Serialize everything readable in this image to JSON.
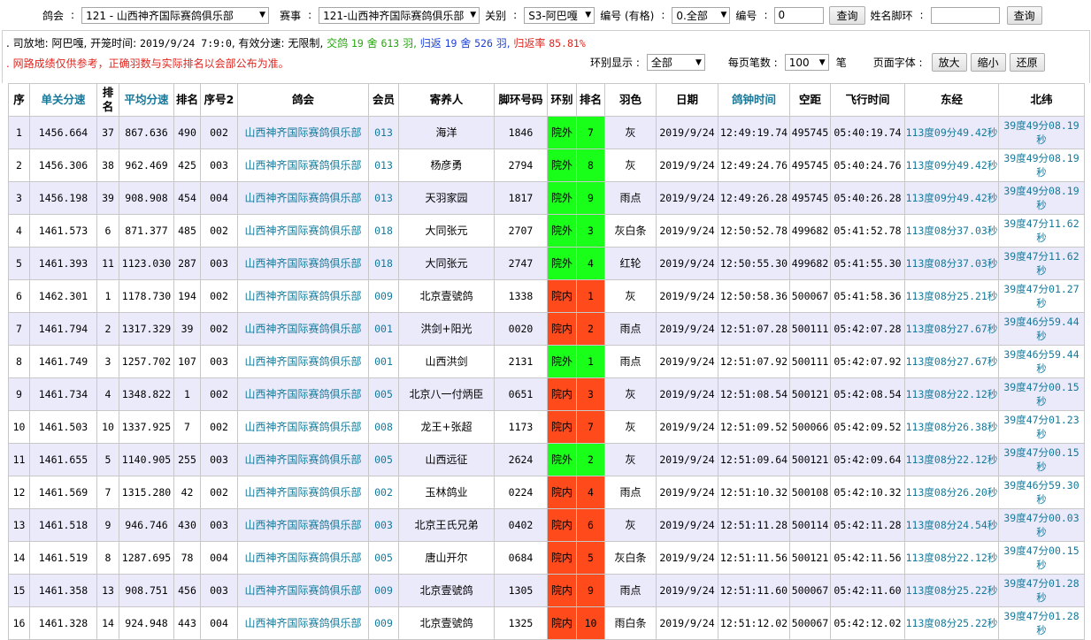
{
  "filters": {
    "club_label": "鸽会",
    "club_value": "121 - 山西神齐国际赛鸽俱乐部",
    "event_label": "赛事",
    "event_value": "121-山西神齐国际赛鸽俱乐部",
    "stage_label": "关别",
    "stage_value": "S3-阿巴嘎",
    "number_label": "编号 (有格)",
    "number_select": "0.全部",
    "number2_label": "编号",
    "number_input": "0",
    "query_label": "查询",
    "name_label": "姓名脚环",
    "name_input": "",
    "query2_label": "查询"
  },
  "info": {
    "site_label": ". 司放地:",
    "site_value": "阿巴嘎",
    "time_label": "开笼时间:",
    "time_value": "2019/9/24 7:9:0",
    "speed_label": "有效分速:",
    "speed_value": "无限制",
    "sent_label": "交鸽",
    "sent_count": "19",
    "sent_unit1": "舍",
    "sent_birds": "613",
    "sent_unit2": "羽",
    "return_label": "归返",
    "return_count": "19",
    "return_unit1": "舍",
    "return_birds": "526",
    "return_unit2": "羽",
    "rate_label": "归返率",
    "rate_value": "85.81%",
    "notice": ". 网路成绩仅供参考，正确羽数与实际排名以会部公布为准。"
  },
  "controls": {
    "ring_display_label": "环别显示 :",
    "ring_display_value": "全部",
    "per_page_label": "每页笔数 :",
    "per_page_value": "100",
    "per_page_unit": "笔",
    "font_label": "页面字体 :",
    "zoom_in": "放大",
    "zoom_out": "缩小",
    "reset": "还原"
  },
  "table": {
    "headers": [
      "序",
      "单关分速",
      "排名",
      "平均分速",
      "排名",
      "序号2",
      "鸽会",
      "会员",
      "寄养人",
      "脚环号码",
      "环别",
      "排名",
      "羽色",
      "日期",
      "鸽钟时间",
      "空距",
      "飞行时间",
      "东经",
      "北纬"
    ],
    "rows": [
      {
        "seq": "1",
        "speed": "1456.664",
        "rank1": "37",
        "avg": "867.636",
        "rank2": "490",
        "no2": "002",
        "club": "山西神齐国际赛鸽俱乐部",
        "member": "013",
        "owner": "海洋",
        "ring": "1846",
        "ring_type": "院外",
        "rank3": "7",
        "color": "灰",
        "date": "2019/9/24",
        "clock": "12:49:19.74",
        "dist": "495745",
        "flight": "05:40:19.74",
        "lon": "113度09分49.42秒",
        "lat": "39度49分08.19秒"
      },
      {
        "seq": "2",
        "speed": "1456.306",
        "rank1": "38",
        "avg": "962.469",
        "rank2": "425",
        "no2": "003",
        "club": "山西神齐国际赛鸽俱乐部",
        "member": "013",
        "owner": "杨彦勇",
        "ring": "2794",
        "ring_type": "院外",
        "rank3": "8",
        "color": "灰",
        "date": "2019/9/24",
        "clock": "12:49:24.76",
        "dist": "495745",
        "flight": "05:40:24.76",
        "lon": "113度09分49.42秒",
        "lat": "39度49分08.19秒"
      },
      {
        "seq": "3",
        "speed": "1456.198",
        "rank1": "39",
        "avg": "908.908",
        "rank2": "454",
        "no2": "004",
        "club": "山西神齐国际赛鸽俱乐部",
        "member": "013",
        "owner": "天羽家园",
        "ring": "1817",
        "ring_type": "院外",
        "rank3": "9",
        "color": "雨点",
        "date": "2019/9/24",
        "clock": "12:49:26.28",
        "dist": "495745",
        "flight": "05:40:26.28",
        "lon": "113度09分49.42秒",
        "lat": "39度49分08.19秒"
      },
      {
        "seq": "4",
        "speed": "1461.573",
        "rank1": "6",
        "avg": "871.377",
        "rank2": "485",
        "no2": "002",
        "club": "山西神齐国际赛鸽俱乐部",
        "member": "018",
        "owner": "大同张元",
        "ring": "2707",
        "ring_type": "院外",
        "rank3": "3",
        "color": "灰白条",
        "date": "2019/9/24",
        "clock": "12:50:52.78",
        "dist": "499682",
        "flight": "05:41:52.78",
        "lon": "113度08分37.03秒",
        "lat": "39度47分11.62秒"
      },
      {
        "seq": "5",
        "speed": "1461.393",
        "rank1": "11",
        "avg": "1123.030",
        "rank2": "287",
        "no2": "003",
        "club": "山西神齐国际赛鸽俱乐部",
        "member": "018",
        "owner": "大同张元",
        "ring": "2747",
        "ring_type": "院外",
        "rank3": "4",
        "color": "红轮",
        "date": "2019/9/24",
        "clock": "12:50:55.30",
        "dist": "499682",
        "flight": "05:41:55.30",
        "lon": "113度08分37.03秒",
        "lat": "39度47分11.62秒"
      },
      {
        "seq": "6",
        "speed": "1462.301",
        "rank1": "1",
        "avg": "1178.730",
        "rank2": "194",
        "no2": "002",
        "club": "山西神齐国际赛鸽俱乐部",
        "member": "009",
        "owner": "北京壹號鸽",
        "ring": "1338",
        "ring_type": "院内",
        "rank3": "1",
        "color": "灰",
        "date": "2019/9/24",
        "clock": "12:50:58.36",
        "dist": "500067",
        "flight": "05:41:58.36",
        "lon": "113度08分25.21秒",
        "lat": "39度47分01.27秒"
      },
      {
        "seq": "7",
        "speed": "1461.794",
        "rank1": "2",
        "avg": "1317.329",
        "rank2": "39",
        "no2": "002",
        "club": "山西神齐国际赛鸽俱乐部",
        "member": "001",
        "owner": "洪剑+阳光",
        "ring": "0020",
        "ring_type": "院内",
        "rank3": "2",
        "color": "雨点",
        "date": "2019/9/24",
        "clock": "12:51:07.28",
        "dist": "500111",
        "flight": "05:42:07.28",
        "lon": "113度08分27.67秒",
        "lat": "39度46分59.44秒"
      },
      {
        "seq": "8",
        "speed": "1461.749",
        "rank1": "3",
        "avg": "1257.702",
        "rank2": "107",
        "no2": "003",
        "club": "山西神齐国际赛鸽俱乐部",
        "member": "001",
        "owner": "山西洪剑",
        "ring": "2131",
        "ring_type": "院外",
        "rank3": "1",
        "color": "雨点",
        "date": "2019/9/24",
        "clock": "12:51:07.92",
        "dist": "500111",
        "flight": "05:42:07.92",
        "lon": "113度08分27.67秒",
        "lat": "39度46分59.44秒"
      },
      {
        "seq": "9",
        "speed": "1461.734",
        "rank1": "4",
        "avg": "1348.822",
        "rank2": "1",
        "no2": "002",
        "club": "山西神齐国际赛鸽俱乐部",
        "member": "005",
        "owner": "北京八一付炳臣",
        "ring": "0651",
        "ring_type": "院内",
        "rank3": "3",
        "color": "灰",
        "date": "2019/9/24",
        "clock": "12:51:08.54",
        "dist": "500121",
        "flight": "05:42:08.54",
        "lon": "113度08分22.12秒",
        "lat": "39度47分00.15秒"
      },
      {
        "seq": "10",
        "speed": "1461.503",
        "rank1": "10",
        "avg": "1337.925",
        "rank2": "7",
        "no2": "002",
        "club": "山西神齐国际赛鸽俱乐部",
        "member": "008",
        "owner": "龙王+张超",
        "ring": "1173",
        "ring_type": "院内",
        "rank3": "7",
        "color": "灰",
        "date": "2019/9/24",
        "clock": "12:51:09.52",
        "dist": "500066",
        "flight": "05:42:09.52",
        "lon": "113度08分26.38秒",
        "lat": "39度47分01.23秒"
      },
      {
        "seq": "11",
        "speed": "1461.655",
        "rank1": "5",
        "avg": "1140.905",
        "rank2": "255",
        "no2": "003",
        "club": "山西神齐国际赛鸽俱乐部",
        "member": "005",
        "owner": "山西远征",
        "ring": "2624",
        "ring_type": "院外",
        "rank3": "2",
        "color": "灰",
        "date": "2019/9/24",
        "clock": "12:51:09.64",
        "dist": "500121",
        "flight": "05:42:09.64",
        "lon": "113度08分22.12秒",
        "lat": "39度47分00.15秒"
      },
      {
        "seq": "12",
        "speed": "1461.569",
        "rank1": "7",
        "avg": "1315.280",
        "rank2": "42",
        "no2": "002",
        "club": "山西神齐国际赛鸽俱乐部",
        "member": "002",
        "owner": "玉林鸽业",
        "ring": "0224",
        "ring_type": "院内",
        "rank3": "4",
        "color": "雨点",
        "date": "2019/9/24",
        "clock": "12:51:10.32",
        "dist": "500108",
        "flight": "05:42:10.32",
        "lon": "113度08分26.20秒",
        "lat": "39度46分59.30秒"
      },
      {
        "seq": "13",
        "speed": "1461.518",
        "rank1": "9",
        "avg": "946.746",
        "rank2": "430",
        "no2": "003",
        "club": "山西神齐国际赛鸽俱乐部",
        "member": "003",
        "owner": "北京王氏兄弟",
        "ring": "0402",
        "ring_type": "院内",
        "rank3": "6",
        "color": "灰",
        "date": "2019/9/24",
        "clock": "12:51:11.28",
        "dist": "500114",
        "flight": "05:42:11.28",
        "lon": "113度08分24.54秒",
        "lat": "39度47分00.03秒"
      },
      {
        "seq": "14",
        "speed": "1461.519",
        "rank1": "8",
        "avg": "1287.695",
        "rank2": "78",
        "no2": "004",
        "club": "山西神齐国际赛鸽俱乐部",
        "member": "005",
        "owner": "唐山开尔",
        "ring": "0684",
        "ring_type": "院内",
        "rank3": "5",
        "color": "灰白条",
        "date": "2019/9/24",
        "clock": "12:51:11.56",
        "dist": "500121",
        "flight": "05:42:11.56",
        "lon": "113度08分22.12秒",
        "lat": "39度47分00.15秒"
      },
      {
        "seq": "15",
        "speed": "1461.358",
        "rank1": "13",
        "avg": "908.751",
        "rank2": "456",
        "no2": "003",
        "club": "山西神齐国际赛鸽俱乐部",
        "member": "009",
        "owner": "北京壹號鸽",
        "ring": "1305",
        "ring_type": "院内",
        "rank3": "9",
        "color": "雨点",
        "date": "2019/9/24",
        "clock": "12:51:11.60",
        "dist": "500067",
        "flight": "05:42:11.60",
        "lon": "113度08分25.22秒",
        "lat": "39度47分01.28秒"
      },
      {
        "seq": "16",
        "speed": "1461.328",
        "rank1": "14",
        "avg": "924.948",
        "rank2": "443",
        "no2": "004",
        "club": "山西神齐国际赛鸽俱乐部",
        "member": "009",
        "owner": "北京壹號鸽",
        "ring": "1325",
        "ring_type": "院内",
        "rank3": "10",
        "color": "雨白条",
        "date": "2019/9/24",
        "clock": "12:51:12.02",
        "dist": "500067",
        "flight": "05:42:12.02",
        "lon": "113度08分25.22秒",
        "lat": "39度47分01.28秒"
      }
    ]
  },
  "colors": {
    "ring_out": "#1aff1a",
    "ring_in": "#ff4a1c",
    "link": "#17799a",
    "row_odd": "#eaeafb"
  }
}
